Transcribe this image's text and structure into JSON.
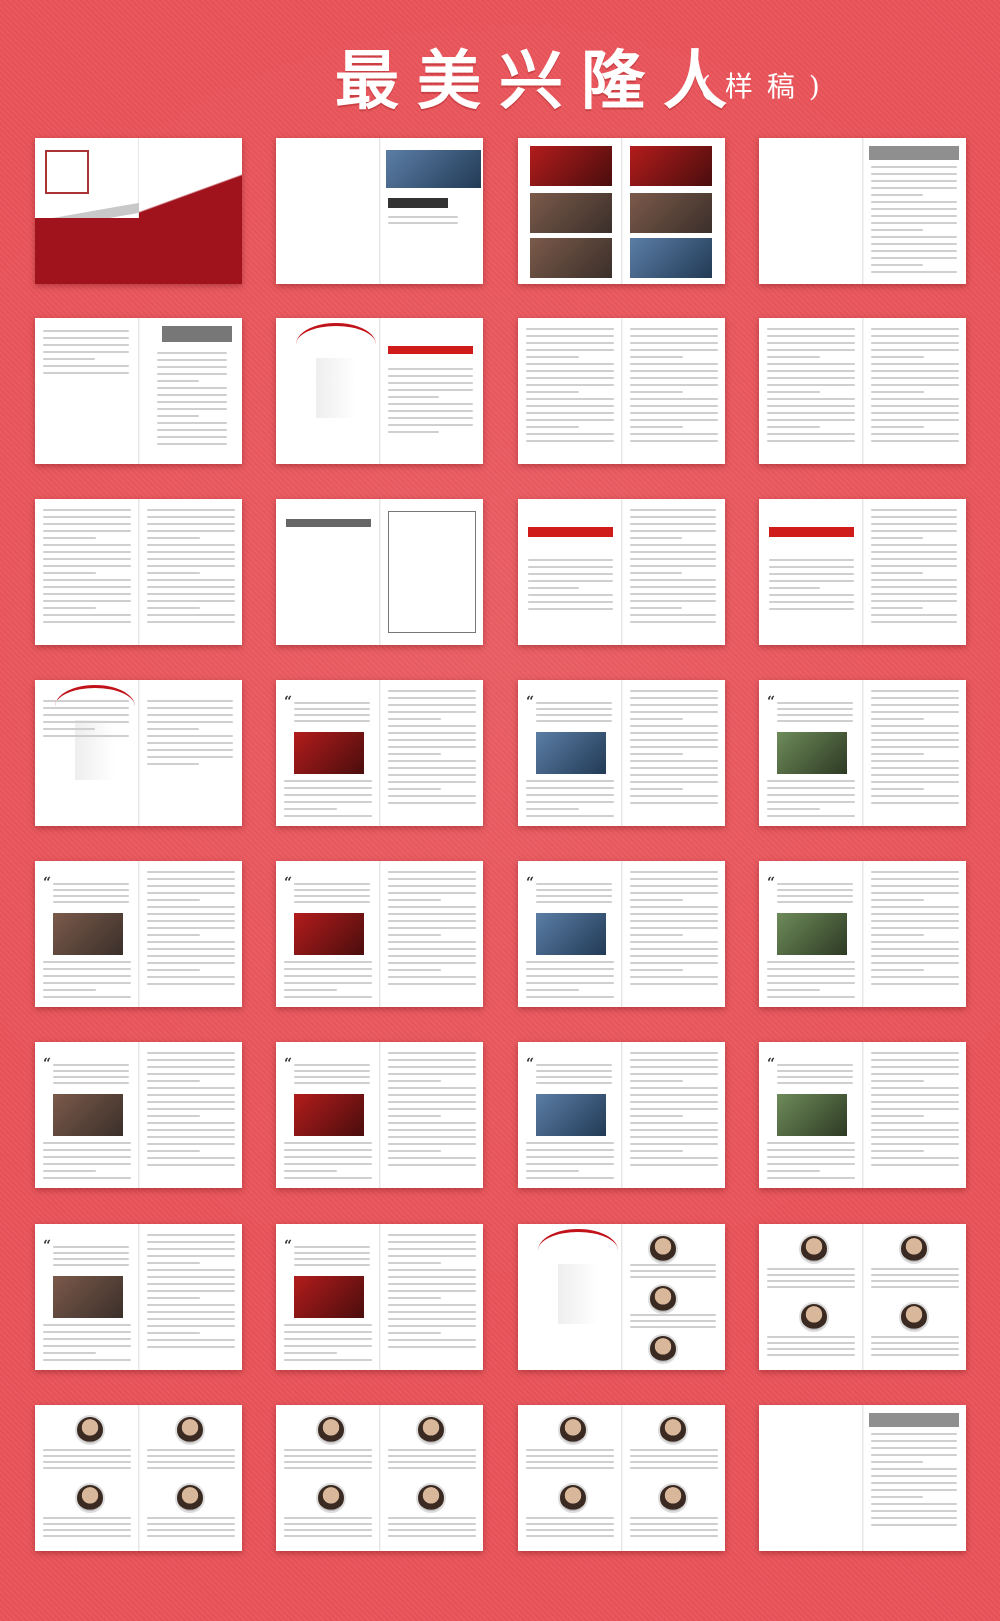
{
  "header": {
    "title": "最美兴隆人",
    "subtitle": "(样稿)"
  },
  "colors": {
    "background": "#e9545a",
    "accent": "#c1121a",
    "paper": "#ffffff"
  },
  "spreads": [
    {
      "type": "cover"
    },
    {
      "type": "title"
    },
    {
      "type": "photos"
    },
    {
      "type": "preface"
    },
    {
      "type": "toc"
    },
    {
      "type": "ribbon-doc"
    },
    {
      "type": "text"
    },
    {
      "type": "text"
    },
    {
      "type": "text"
    },
    {
      "type": "form"
    },
    {
      "type": "red-doc"
    },
    {
      "type": "red-doc"
    },
    {
      "type": "ribbon-section"
    },
    {
      "type": "article"
    },
    {
      "type": "article"
    },
    {
      "type": "article"
    },
    {
      "type": "article"
    },
    {
      "type": "article"
    },
    {
      "type": "article"
    },
    {
      "type": "article"
    },
    {
      "type": "article"
    },
    {
      "type": "article"
    },
    {
      "type": "article"
    },
    {
      "type": "article"
    },
    {
      "type": "article"
    },
    {
      "type": "article"
    },
    {
      "type": "ribbon-portraits"
    },
    {
      "type": "portraits"
    },
    {
      "type": "portraits"
    },
    {
      "type": "portraits"
    },
    {
      "type": "portraits"
    },
    {
      "type": "afterword"
    }
  ]
}
